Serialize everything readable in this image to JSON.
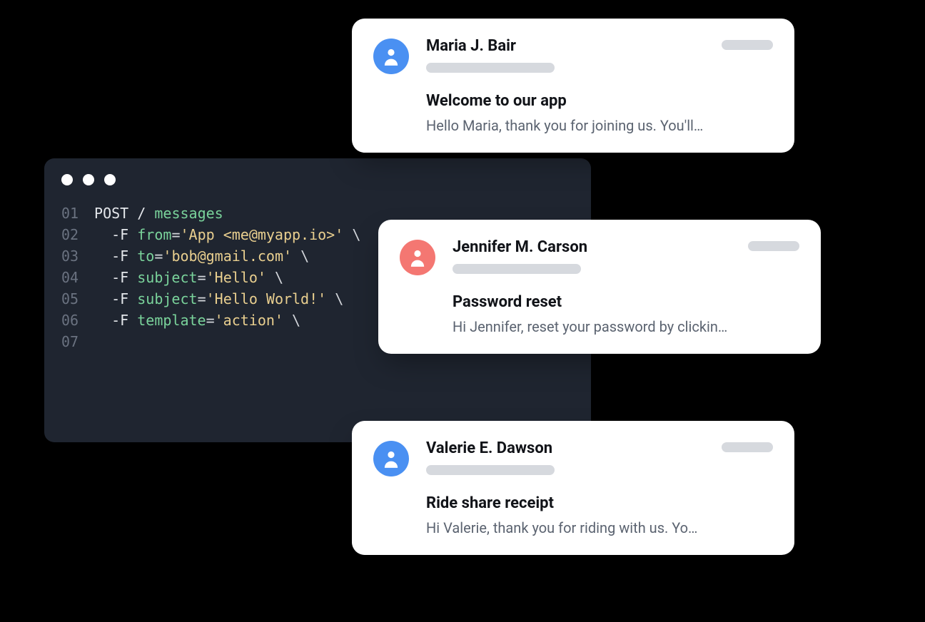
{
  "code": {
    "lines": [
      {
        "num": "01",
        "html": "<span class='kw'>POST</span> <span class='kw'>/</span> <span class='path'>messages</span>"
      },
      {
        "num": "02",
        "html": "  <span class='kw'>-F</span> <span class='key'>from</span><span class='eq'>=</span><span class='str'>'App &lt;me@myapp.io&gt;'</span> <span class='bs'>\\</span>"
      },
      {
        "num": "03",
        "html": "  <span class='kw'>-F</span> <span class='key'>to</span><span class='eq'>=</span><span class='str'>'bob@gmail.com'</span> <span class='bs'>\\</span>"
      },
      {
        "num": "04",
        "html": "  <span class='kw'>-F</span> <span class='key'>subject</span><span class='eq'>=</span><span class='str'>'Hello'</span> <span class='bs'>\\</span>"
      },
      {
        "num": "05",
        "html": "  <span class='kw'>-F</span> <span class='key'>subject</span><span class='eq'>=</span><span class='str'>'Hello World!'</span> <span class='bs'>\\</span>"
      },
      {
        "num": "06",
        "html": "  <span class='kw'>-F</span> <span class='key'>template</span><span class='eq'>=</span><span class='str'>'action'</span> <span class='bs'>\\</span>"
      },
      {
        "num": "07",
        "html": ""
      }
    ]
  },
  "cards": [
    {
      "avatar_color": "blue",
      "sender": "Maria J. Bair",
      "subject": "Welcome to our app",
      "preview": "Hello Maria, thank you for joining us. You'll…"
    },
    {
      "avatar_color": "red",
      "sender": "Jennifer M. Carson",
      "subject": "Password reset",
      "preview": "Hi Jennifer, reset your password by clickin…"
    },
    {
      "avatar_color": "blue",
      "sender": "Valerie E. Dawson",
      "subject": "Ride share receipt",
      "preview": "Hi Valerie, thank you for riding with us. Yo…"
    }
  ]
}
